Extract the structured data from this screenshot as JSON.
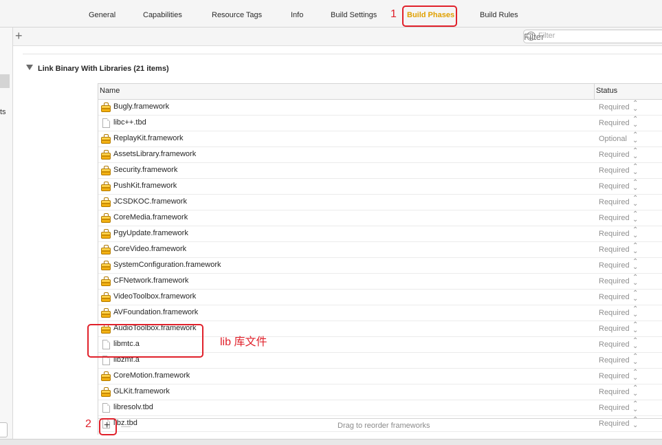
{
  "tabs": [
    {
      "label": "General"
    },
    {
      "label": "Capabilities"
    },
    {
      "label": "Resource Tags"
    },
    {
      "label": "Info"
    },
    {
      "label": "Build Settings"
    },
    {
      "label": "Build Phases",
      "active": true
    },
    {
      "label": "Build Rules"
    }
  ],
  "left_fragment": "ts",
  "toolbar": {
    "add_symbol": "+",
    "filter_placeholder": "Filter"
  },
  "section": {
    "title": "Link Binary With Libraries (21 items)"
  },
  "table": {
    "columns": [
      "Name",
      "Status"
    ],
    "rows": [
      {
        "name": "Bugly.framework",
        "type": "framework",
        "status": "Required"
      },
      {
        "name": "libc++.tbd",
        "type": "file",
        "status": "Required"
      },
      {
        "name": "ReplayKit.framework",
        "type": "framework",
        "status": "Optional"
      },
      {
        "name": "AssetsLibrary.framework",
        "type": "framework",
        "status": "Required"
      },
      {
        "name": "Security.framework",
        "type": "framework",
        "status": "Required"
      },
      {
        "name": "PushKit.framework",
        "type": "framework",
        "status": "Required"
      },
      {
        "name": "JCSDKOC.framework",
        "type": "framework",
        "status": "Required"
      },
      {
        "name": "CoreMedia.framework",
        "type": "framework",
        "status": "Required"
      },
      {
        "name": "PgyUpdate.framework",
        "type": "framework",
        "status": "Required"
      },
      {
        "name": "CoreVideo.framework",
        "type": "framework",
        "status": "Required"
      },
      {
        "name": "SystemConfiguration.framework",
        "type": "framework",
        "status": "Required"
      },
      {
        "name": "CFNetwork.framework",
        "type": "framework",
        "status": "Required"
      },
      {
        "name": "VideoToolbox.framework",
        "type": "framework",
        "status": "Required"
      },
      {
        "name": "AVFoundation.framework",
        "type": "framework",
        "status": "Required"
      },
      {
        "name": "AudioToolbox.framework",
        "type": "framework",
        "status": "Required"
      },
      {
        "name": "libmtc.a",
        "type": "file",
        "status": "Required"
      },
      {
        "name": "libzmf.a",
        "type": "file",
        "status": "Required"
      },
      {
        "name": "CoreMotion.framework",
        "type": "framework",
        "status": "Required"
      },
      {
        "name": "GLKit.framework",
        "type": "framework",
        "status": "Required"
      },
      {
        "name": "libresolv.tbd",
        "type": "file",
        "status": "Required"
      },
      {
        "name": "libz.tbd",
        "type": "file",
        "status": "Required"
      }
    ]
  },
  "footer": {
    "add_symbol": "+",
    "remove_symbol": "—",
    "hint": "Drag to reorder frameworks"
  },
  "annotations": {
    "label_1": "1",
    "label_2": "2",
    "lib_note": "lib 库文件"
  },
  "colors": {
    "accent": "#e0a000",
    "annotation": "#e0202a"
  }
}
